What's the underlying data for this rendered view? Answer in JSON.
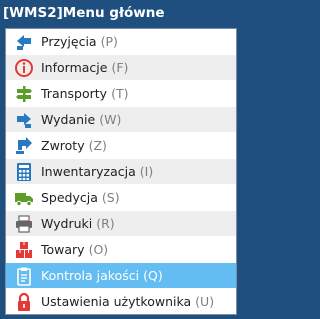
{
  "window": {
    "title": "[WMS2]Menu główne"
  },
  "menu": {
    "items": [
      {
        "label": "Przyjęcia",
        "key": "(P)",
        "icon": "arrow-in-icon",
        "color": "#2979c0"
      },
      {
        "label": "Informacje",
        "key": "(F)",
        "icon": "info-icon",
        "color": "#e53935"
      },
      {
        "label": "Transporty",
        "key": "(T)",
        "icon": "signpost-icon",
        "color": "#5e9c2a"
      },
      {
        "label": "Wydanie",
        "key": "(W)",
        "icon": "arrow-out-icon",
        "color": "#2979c0"
      },
      {
        "label": "Zwroty",
        "key": "(Z)",
        "icon": "return-icon",
        "color": "#2979c0"
      },
      {
        "label": "Inwentaryzacja",
        "key": "(I)",
        "icon": "calculator-icon",
        "color": "#2979c0"
      },
      {
        "label": "Spedycja",
        "key": "(S)",
        "icon": "truck-icon",
        "color": "#5e9c2a"
      },
      {
        "label": "Wydruki",
        "key": "(R)",
        "icon": "printer-icon",
        "color": "#666666"
      },
      {
        "label": "Towary",
        "key": "(O)",
        "icon": "boxes-icon",
        "color": "#e53935"
      },
      {
        "label": "Kontrola jakości",
        "key": "(Q)",
        "icon": "clipboard-icon",
        "color": "#ffffff",
        "selected": true
      },
      {
        "label": "Ustawienia użytkownika",
        "key": "(U)",
        "icon": "lock-icon",
        "color": "#e53935"
      }
    ]
  }
}
